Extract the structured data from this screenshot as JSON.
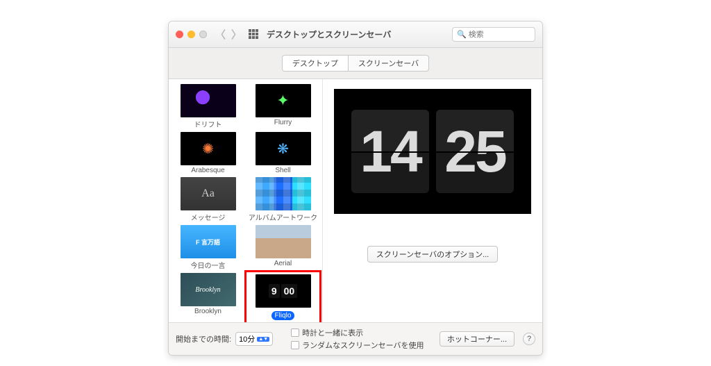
{
  "titlebar": {
    "title": "デスクトップとスクリーンセーバ",
    "search_placeholder": "検索"
  },
  "tabs": {
    "desktop": "デスクトップ",
    "screensaver": "スクリーンセーバ"
  },
  "screensavers": {
    "drift": "ドリフト",
    "flurry": "Flurry",
    "arabesque": "Arabesque",
    "shell": "Shell",
    "message": "メッセージ",
    "album": "アルバムアートワーク",
    "quote": "今日の一言",
    "aerial": "Aerial",
    "brooklyn": "Brooklyn",
    "fliqlo": "Fliqlo",
    "fliqlo_thumb": {
      "hour": "9",
      "minute": "00"
    }
  },
  "preview": {
    "hours": "14",
    "minutes": "25"
  },
  "buttons": {
    "options": "スクリーンセーバのオプション...",
    "hotcorners": "ホットコーナー..."
  },
  "footer": {
    "start_after_label": "開始までの時間:",
    "start_after_value": "10分",
    "show_with_clock": "時計と一緒に表示",
    "random": "ランダムなスクリーンセーバを使用"
  }
}
